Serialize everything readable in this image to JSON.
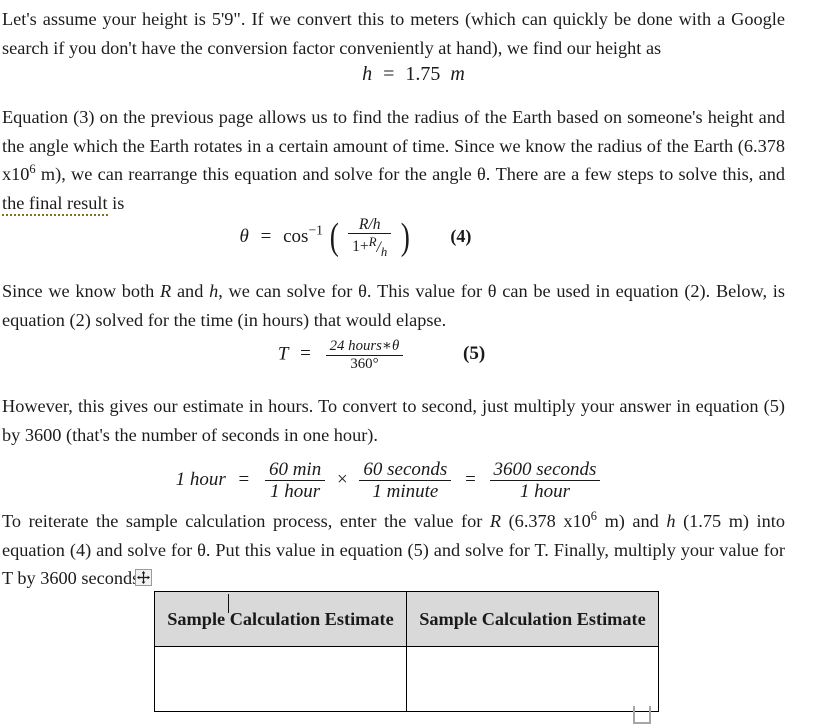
{
  "document": {
    "paragraphs": {
      "p1": "Let's assume your height is 5'9\". If we convert this to meters (which can quickly be done with a Google search if you don't have the conversion factor conveniently at hand), we find our height as",
      "p2_part1": "Equation (3) on the previous page allows us to find the radius of the Earth based on someone's height and the angle which the Earth rotates in a certain amount of time. Since we know the radius of the Earth (6.378 x10",
      "p2_sup": "6",
      "p2_part2": " m), we can rearrange this equation and solve for the angle θ. There are a few steps to solve this, and ",
      "p2_grammar": "the final result",
      "p2_part3": " is",
      "p3_part1": "Since we know both ",
      "p3_R": "R",
      "p3_part2": " and ",
      "p3_h": "h",
      "p3_part3": ", we can solve for θ. This value for θ can be used in equation (2). Below, is equation (2) solved for the time (in hours) that would elapse.",
      "p4": "However, this gives our estimate in hours. To convert to second, just multiply your answer in equation (5) by 3600 (that's the number of seconds in one hour).",
      "p5_part1": "To reiterate the sample calculation process, enter the value for ",
      "p5_R": "R",
      "p5_part2": " (6.378 x10",
      "p5_sup": "6",
      "p5_part3": " m) and ",
      "p5_h": "h",
      "p5_part4": " (1.75 m) into equation (4) and solve for θ. Put this value in equation (5) and solve for T. Finally, multiply your value for T by 3600 seconds."
    },
    "equations": {
      "height": {
        "lhs": "h",
        "eq": "=",
        "rhs": "1.75",
        "unit": "m"
      },
      "eq4": {
        "lhs": "θ",
        "eq": "=",
        "func": "cos",
        "exponent": "−1",
        "numerator": "R/h",
        "denominator_prefix": "1+",
        "denominator_R": "R",
        "denominator_slash": "/",
        "denominator_h": "h",
        "number": "(4)"
      },
      "eq5": {
        "lhs": "T",
        "eq": "=",
        "numerator": "24 hours∗θ",
        "denominator": "360°",
        "number": "(5)"
      },
      "conversion": {
        "lhs": "1 hour",
        "eq1": "=",
        "f1_num": "60 min",
        "f1_den": "1 hour",
        "times": "×",
        "f2_num": "60 seconds",
        "f2_den": "1 minute",
        "eq2": "=",
        "f3_num": "3600 seconds",
        "f3_den": "1 hour"
      }
    },
    "table": {
      "headers": [
        "Sample Calculation Estimate",
        "Sample Calculation Estimate"
      ],
      "rows": [
        [
          "",
          ""
        ]
      ]
    },
    "handles": {
      "move_icon": "move-four-arrows-icon",
      "resize_icon": "table-resize-handle-icon",
      "caret": "text-insertion-caret"
    },
    "colors": {
      "header_fill": "#d9d9d9",
      "border": "#000000",
      "grammar_underline": "#8a6d22",
      "text": "#1c1c1c"
    }
  }
}
